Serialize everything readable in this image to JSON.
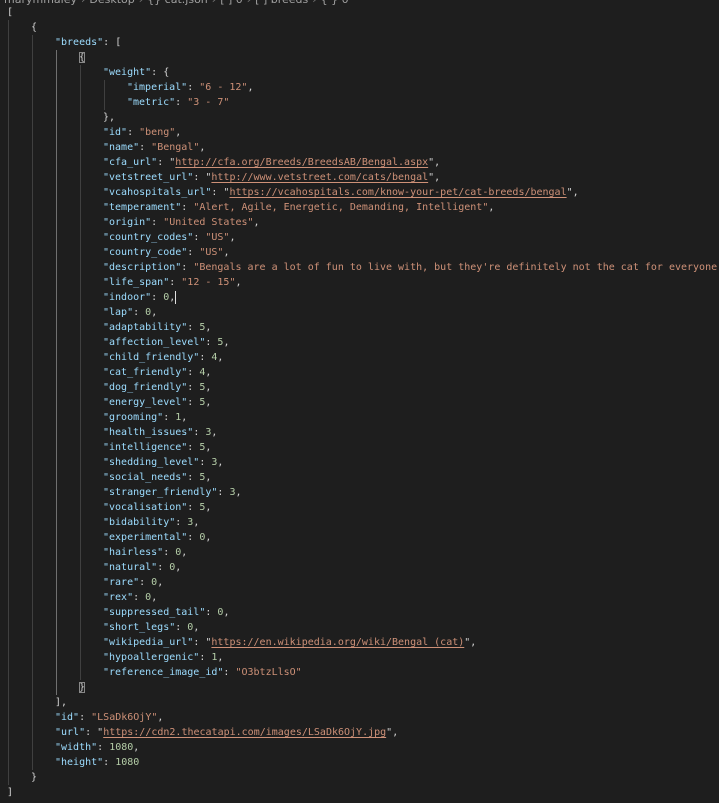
{
  "breadcrumb": [
    "marymmaley",
    "Desktop",
    "{} cat.json",
    "[ ] 0",
    "[ ] breeds",
    "{ } 0"
  ],
  "colors": {
    "background": "#1e1e1e",
    "key": "#9cdcfe",
    "string": "#ce9178",
    "number": "#b5cea8"
  },
  "cursor_after_key": "indoor",
  "document": [
    {
      "breeds": [
        {
          "weight": {
            "imperial": "6 - 12",
            "metric": "3 - 7"
          },
          "id": "beng",
          "name": "Bengal",
          "cfa_url": "http://cfa.org/Breeds/BreedsAB/Bengal.aspx",
          "vetstreet_url": "http://www.vetstreet.com/cats/bengal",
          "vcahospitals_url": "https://vcahospitals.com/know-your-pet/cat-breeds/bengal",
          "temperament": "Alert, Agile, Energetic, Demanding, Intelligent",
          "origin": "United States",
          "country_codes": "US",
          "country_code": "US",
          "description": "Bengals are a lot of fun to live with, but they're definitely not the cat for everyone,",
          "life_span": "12 - 15",
          "indoor": 0,
          "lap": 0,
          "adaptability": 5,
          "affection_level": 5,
          "child_friendly": 4,
          "cat_friendly": 4,
          "dog_friendly": 5,
          "energy_level": 5,
          "grooming": 1,
          "health_issues": 3,
          "intelligence": 5,
          "shedding_level": 3,
          "social_needs": 5,
          "stranger_friendly": 3,
          "vocalisation": 5,
          "bidability": 3,
          "experimental": 0,
          "hairless": 0,
          "natural": 0,
          "rare": 0,
          "rex": 0,
          "suppressed_tail": 0,
          "short_legs": 0,
          "wikipedia_url": "https://en.wikipedia.org/wiki/Bengal_(cat)",
          "hypoallergenic": 1,
          "reference_image_id": "O3btzLlsO"
        }
      ],
      "id": "LSaDk6OjY",
      "url": "https://cdn2.thecatapi.com/images/LSaDk6OjY.jpg",
      "width": 1080,
      "height": 1080
    }
  ]
}
